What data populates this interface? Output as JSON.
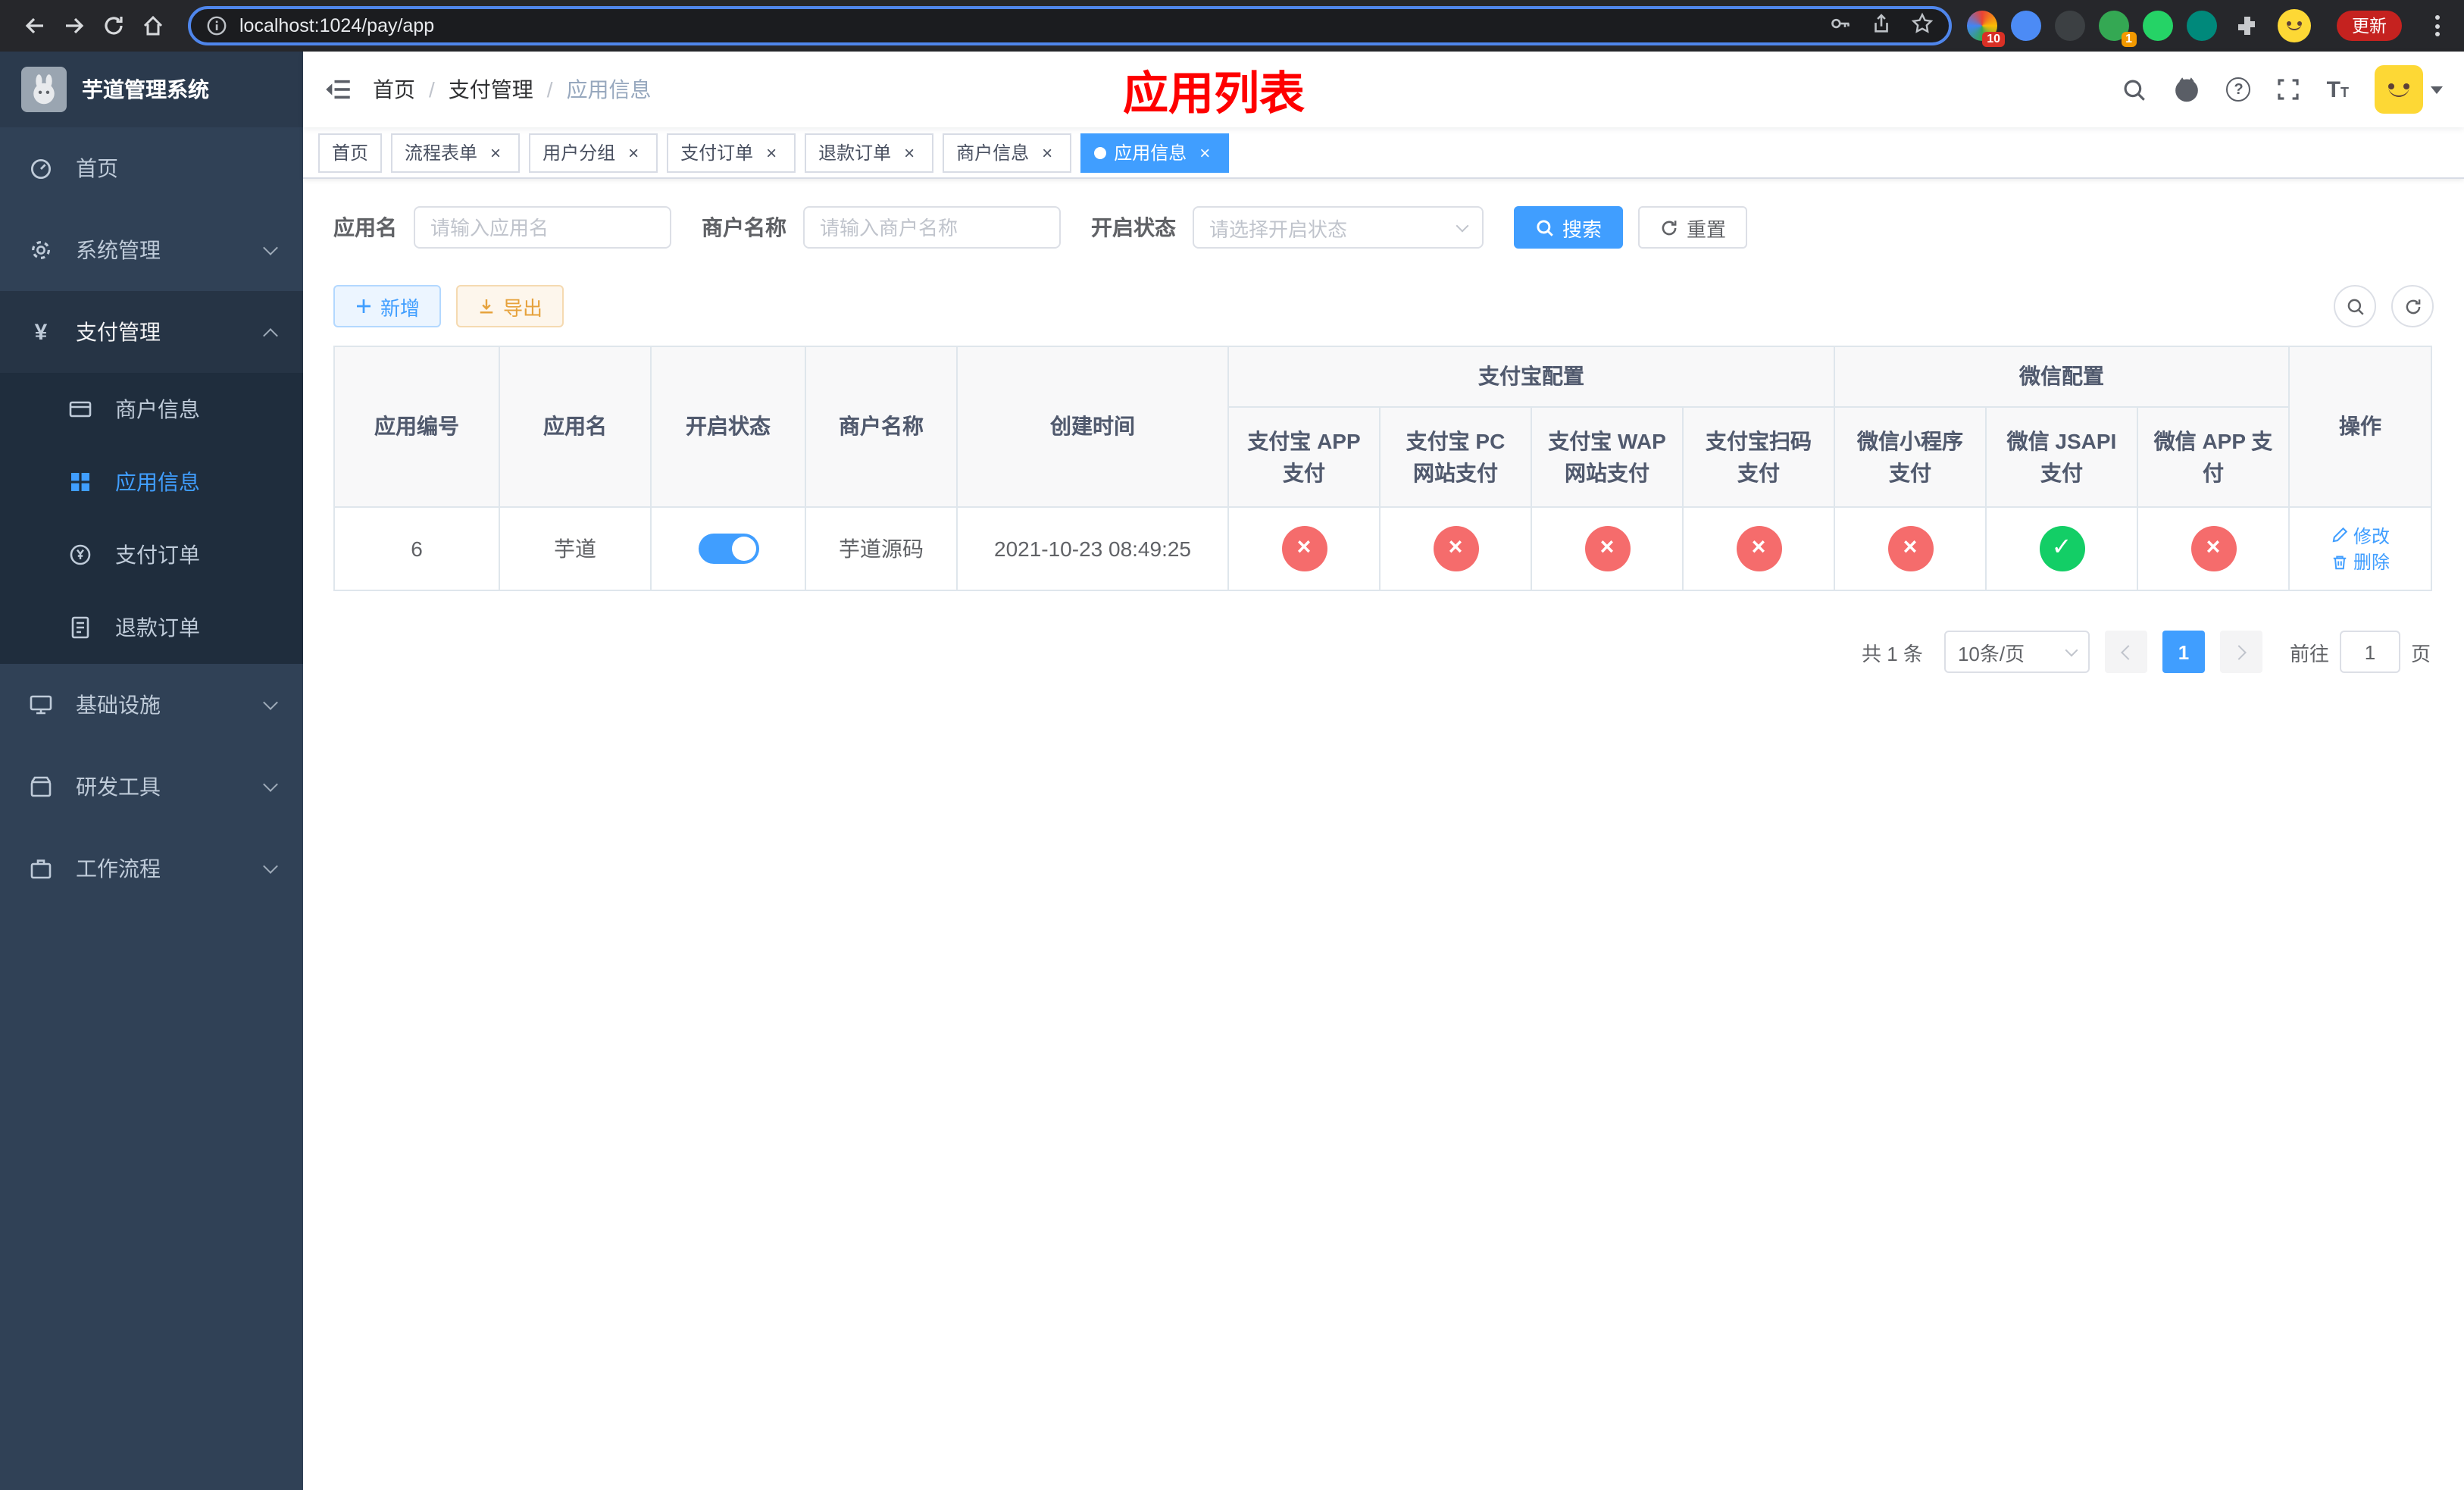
{
  "colors": {
    "accent": "#409eff",
    "danger": "#f56c6c",
    "success": "#13ce66",
    "warning": "#e6a23c",
    "title_red": "#fe0000",
    "sidebar_bg": "#304156",
    "submenu_bg": "#1f2d3d"
  },
  "browser": {
    "url": "localhost:1024/pay/app",
    "update_button": "更新",
    "extension_badge_a": "10",
    "extension_badge_b": "1"
  },
  "sidebar": {
    "logo_title": "芋道管理系统",
    "items": [
      {
        "label": "首页"
      },
      {
        "label": "系统管理"
      },
      {
        "label": "支付管理"
      },
      {
        "label": "商户信息"
      },
      {
        "label": "应用信息"
      },
      {
        "label": "支付订单"
      },
      {
        "label": "退款订单"
      },
      {
        "label": "基础设施"
      },
      {
        "label": "研发工具"
      },
      {
        "label": "工作流程"
      }
    ]
  },
  "header": {
    "breadcrumb": [
      {
        "label": "首页"
      },
      {
        "label": "支付管理"
      },
      {
        "label": "应用信息"
      }
    ],
    "separator": "/",
    "page_title": "应用列表"
  },
  "tabs": [
    {
      "label": "首页"
    },
    {
      "label": "流程表单"
    },
    {
      "label": "用户分组"
    },
    {
      "label": "支付订单"
    },
    {
      "label": "退款订单"
    },
    {
      "label": "商户信息"
    },
    {
      "label": "应用信息"
    }
  ],
  "filters": {
    "app_name_label": "应用名",
    "app_name_placeholder": "请输入应用名",
    "merchant_label": "商户名称",
    "merchant_placeholder": "请输入商户名称",
    "status_label": "开启状态",
    "status_placeholder": "请选择开启状态",
    "search_button": "搜索",
    "reset_button": "重置"
  },
  "toolbar": {
    "add_button": "新增",
    "export_button": "导出"
  },
  "table": {
    "headers": {
      "app_id": "应用编号",
      "app_name": "应用名",
      "status": "开启状态",
      "merchant": "商户名称",
      "created": "创建时间",
      "alipay_group": "支付宝配置",
      "wechat_group": "微信配置",
      "alipay_app": "支付宝 APP 支付",
      "alipay_pc": "支付宝 PC 网站支付",
      "alipay_wap": "支付宝 WAP 网站支付",
      "alipay_qr": "支付宝扫码支付",
      "wechat_mini": "微信小程序支付",
      "wechat_jsapi": "微信 JSAPI 支付",
      "wechat_app": "微信 APP 支付",
      "actions": "操作"
    },
    "row": {
      "app_id": "6",
      "app_name": "芋道",
      "status_class": "on",
      "merchant": "芋道源码",
      "created": "2021-10-23 08:49:25",
      "configs": [
        {
          "glyph": "×",
          "state": "off"
        },
        {
          "glyph": "×",
          "state": "off"
        },
        {
          "glyph": "×",
          "state": "off"
        },
        {
          "glyph": "×",
          "state": "off"
        },
        {
          "glyph": "×",
          "state": "off"
        },
        {
          "glyph": "✓",
          "state": "on"
        },
        {
          "glyph": "×",
          "state": "off"
        }
      ],
      "edit_label": "修改",
      "delete_label": "删除"
    }
  },
  "pagination": {
    "total": "共 1 条",
    "page_size": "10条/页",
    "current_page": "1",
    "goto_label": "前往",
    "goto_value": "1",
    "page_unit": "页"
  }
}
